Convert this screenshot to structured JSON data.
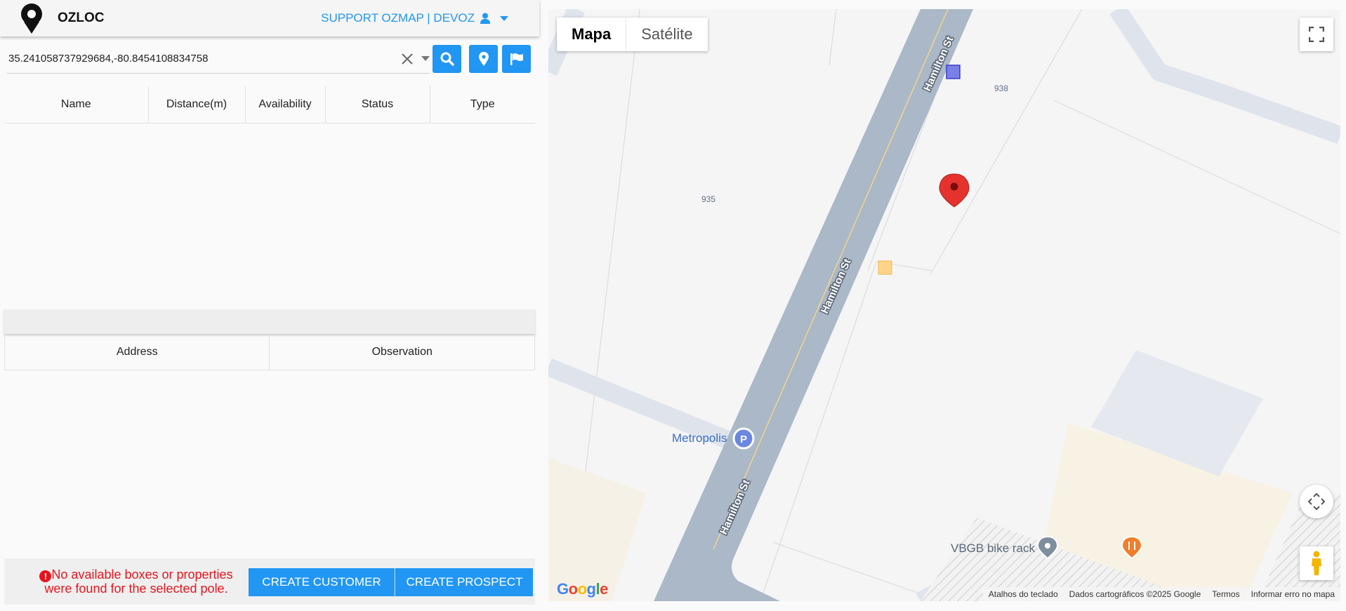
{
  "app": {
    "name": "OZLOC",
    "user_menu": "SUPPORT OZMAP | DEVOZ"
  },
  "search": {
    "value": "35.241058737929684,-80.8454108834758"
  },
  "poles_table": {
    "columns": [
      "Name",
      "Distance(m)",
      "Availability",
      "Status",
      "Type"
    ]
  },
  "address_table": {
    "columns": [
      "Address",
      "Observation"
    ]
  },
  "bottom": {
    "warning_line1": "No available boxes or properties",
    "warning_line2": "were found for the selected pole.",
    "create_customer": "CREATE CUSTOMER",
    "create_prospect": "CREATE PROSPECT"
  },
  "map": {
    "type_tabs": [
      "Mapa",
      "Satélite"
    ],
    "street_labels": [
      "Hamilton St",
      "Hamilton St",
      "Hamilton St"
    ],
    "building_numbers": [
      "938",
      "935"
    ],
    "pois": [
      "Metropolis",
      "VBGB bike rack"
    ],
    "parking_glyph": "P",
    "google_logo": "Google",
    "footer": [
      "Atalhos do teclado",
      "Dados cartográficos ©2025 Google",
      "Termos",
      "Informar erro no mapa"
    ]
  },
  "colors": {
    "accent": "#2196f3",
    "warning": "#e8141d",
    "road": "#aab8c8",
    "marker": "#e5322d"
  },
  "icons": {
    "logo": "location-pin-icon",
    "user": "user-icon",
    "clear": "close-icon",
    "search": "search-icon",
    "pin": "map-marker-icon",
    "flag": "flag-icon",
    "fullscreen": "fullscreen-icon",
    "pan": "pan-arrows-icon",
    "pegman": "street-view-icon"
  }
}
